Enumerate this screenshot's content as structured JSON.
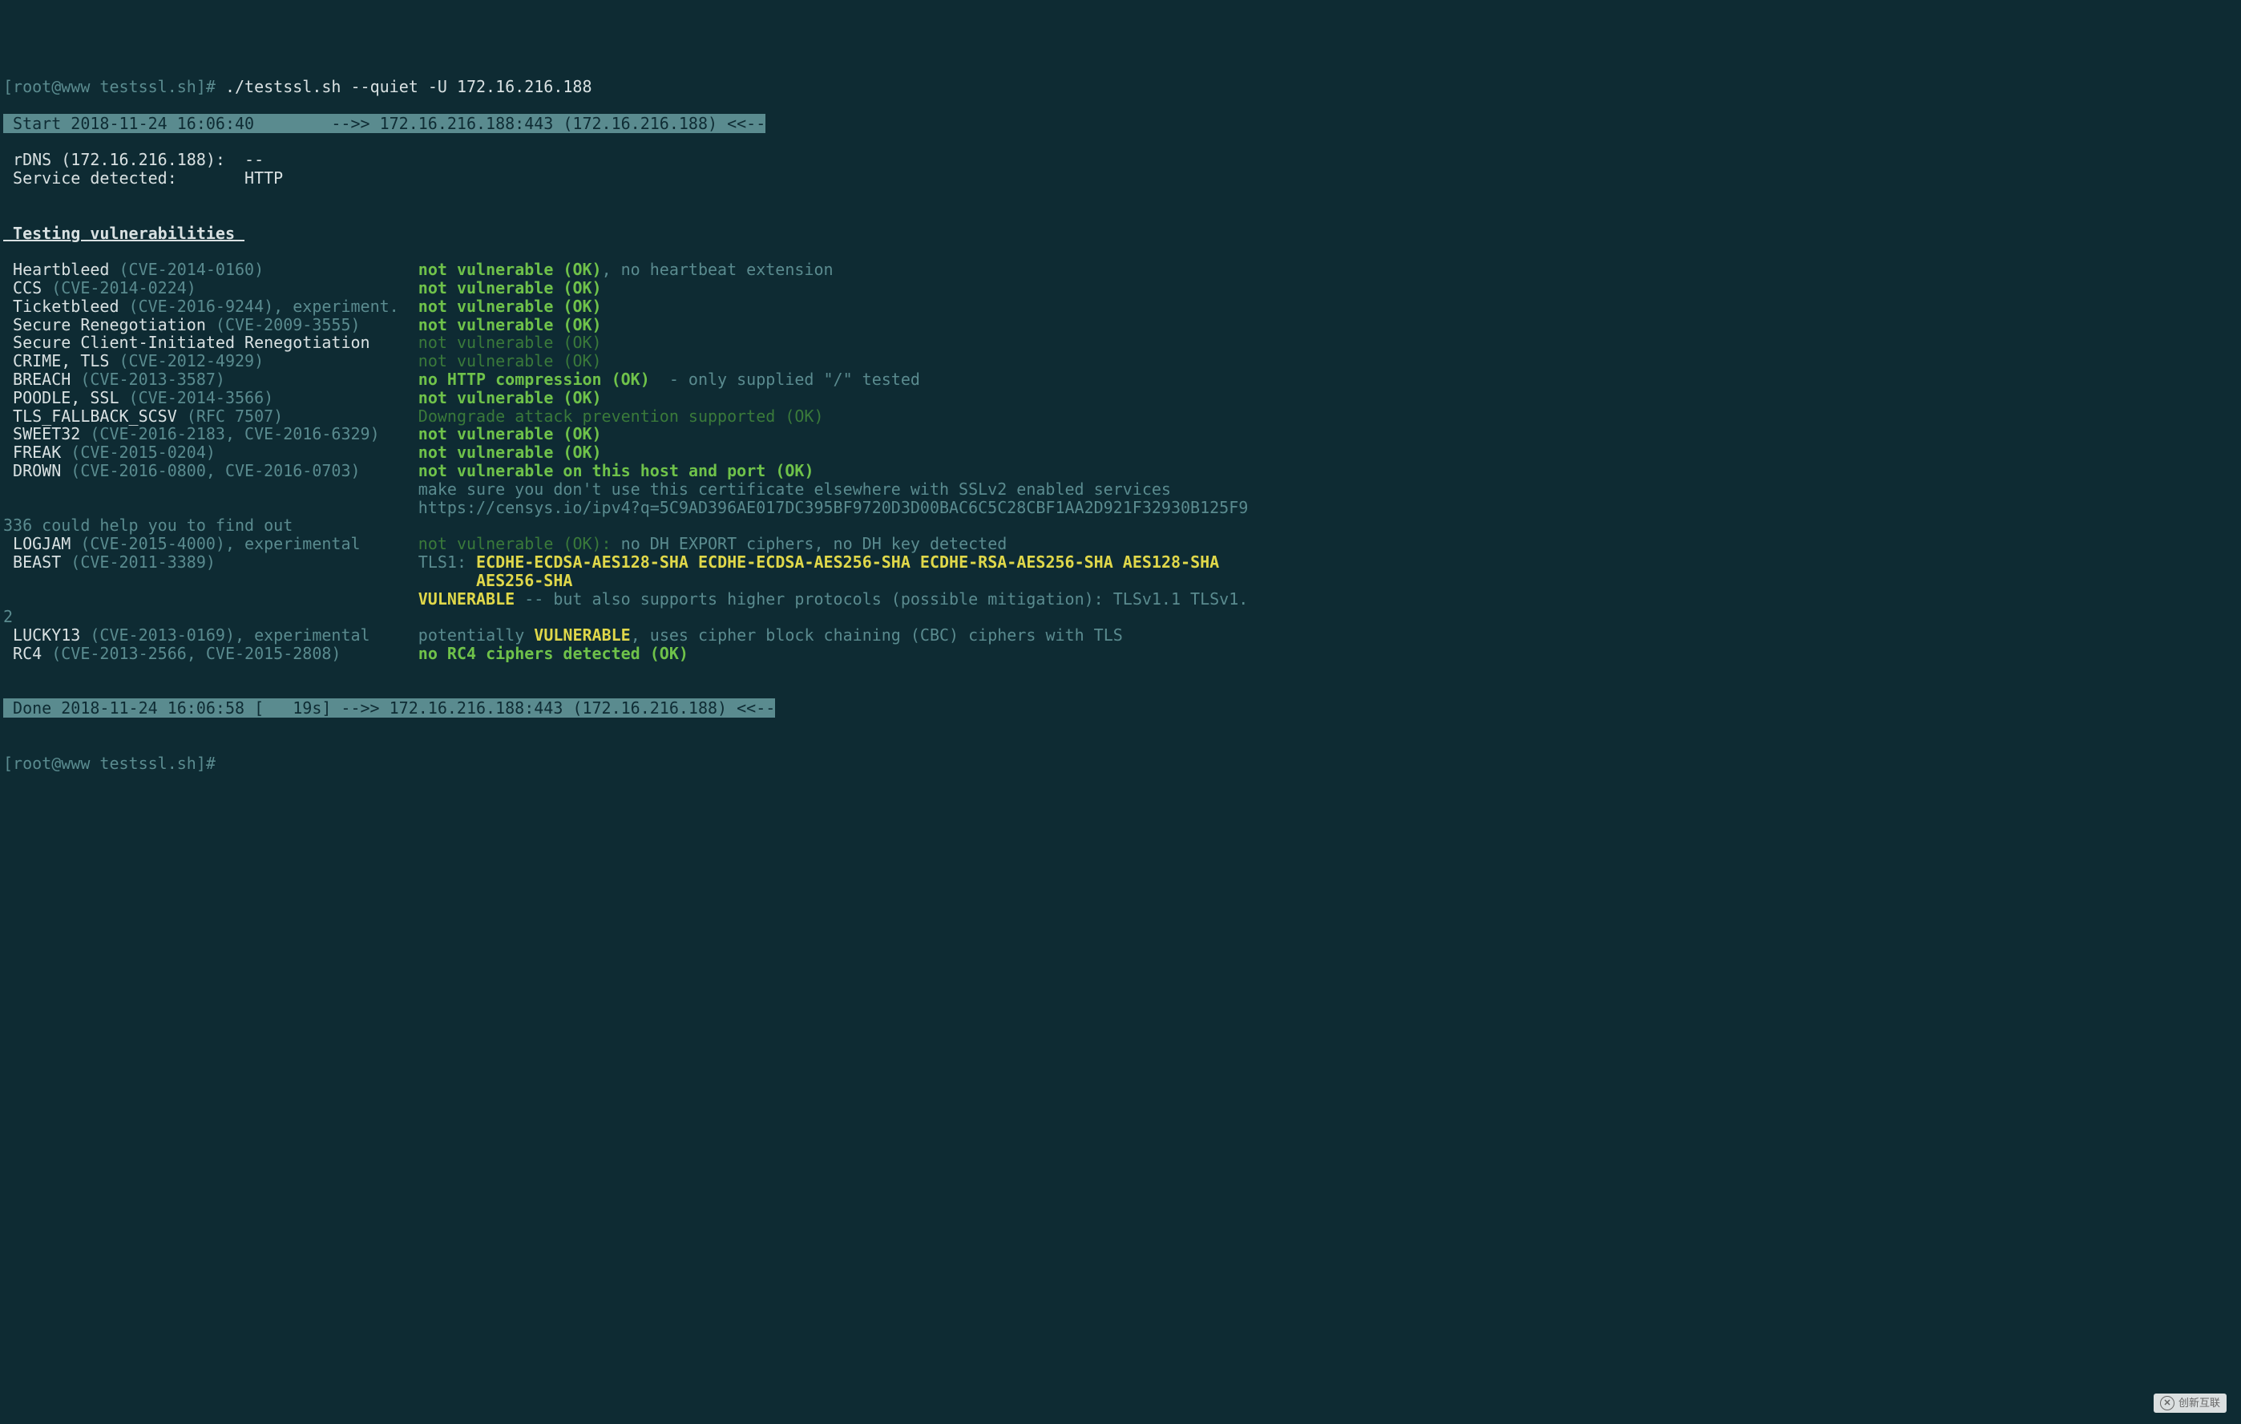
{
  "prompt1": "[root@www testssl.sh]# ",
  "command": "./testssl.sh --quiet -U 172.16.216.188",
  "banner_start": " Start 2018-11-24 16:06:40        -->> 172.16.216.188:443 (172.16.216.188) <<--",
  "rdns_line": " rDNS (172.16.216.188):  --",
  "service_line": " Service detected:       HTTP",
  "section_title": " Testing vulnerabilities ",
  "vulns": [
    {
      "name": "Heartbleed",
      "cve": " (CVE-2014-0160)                ",
      "status": "not vulnerable (OK)",
      "status_class": "green-bold",
      "suffix_grey": ", no heartbeat extension"
    },
    {
      "prefix_pad": " ",
      "name": "CCS",
      "cve": " (CVE-2014-0224)                       ",
      "status": "not vulnerable (OK)",
      "status_class": "green-bold"
    },
    {
      "prefix_pad": " ",
      "name": "Ticketbleed",
      "cve": " (CVE-2016-9244), experiment.  ",
      "status": "not vulnerable (OK)",
      "status_class": "green-bold"
    },
    {
      "prefix_pad": " ",
      "name": "Secure Renegotiation ",
      "cve": "(CVE-2009-3555)      ",
      "status": "not vulnerable (OK)",
      "status_class": "green-bold"
    },
    {
      "prefix_pad": " ",
      "name": "Secure Client-Initiated Renegotiation     ",
      "cve": "",
      "status": "not vulnerable (OK)",
      "status_class": "dark-green"
    },
    {
      "prefix_pad": " ",
      "name": "CRIME, TLS",
      "cve": " (CVE-2012-4929)                ",
      "status": "not vulnerable (OK)",
      "status_class": "dark-green"
    },
    {
      "prefix_pad": " ",
      "name": "BREACH",
      "cve": " (CVE-2013-3587)                    ",
      "status": "no HTTP compression (OK) ",
      "status_class": "green-bold",
      "suffix_grey": " - only supplied \"/\" tested"
    },
    {
      "prefix_pad": " ",
      "name": "POODLE, SSL",
      "cve": " (CVE-2014-3566)               ",
      "status": "not vulnerable (OK)",
      "status_class": "green-bold"
    },
    {
      "prefix_pad": " ",
      "name": "TLS_FALLBACK_SCSV",
      "cve": " (RFC 7507)              ",
      "status": "Downgrade attack prevention supported (OK)",
      "status_class": "dark-green"
    },
    {
      "prefix_pad": " ",
      "name": "SWEET32",
      "cve": " (CVE-2016-2183, CVE-2016-6329)    ",
      "status": "not vulnerable (OK)",
      "status_class": "green-bold"
    },
    {
      "prefix_pad": " ",
      "name": "FREAK",
      "cve": " (CVE-2015-0204)                     ",
      "status": "not vulnerable (OK)",
      "status_class": "green-bold"
    },
    {
      "prefix_pad": " ",
      "name": "DROWN",
      "cve": " (CVE-2016-0800, CVE-2016-0703)      ",
      "status": "not vulnerable on this host and port (OK)",
      "status_class": "green-bold"
    }
  ],
  "drown_line1": "                                           make sure you don't use this certificate elsewhere with SSLv2 enabled services",
  "drown_line2": "                                           https://censys.io/ipv4?q=5C9AD396AE017DC395BF9720D3D00BAC6C5C28CBF1AA2D921F32930B125F9",
  "drown_wrap": "336 could help you to find out",
  "logjam": {
    "name": "LOGJAM",
    "cve": " (CVE-2015-4000), experimental      ",
    "status": "not vulnerable (OK):",
    "detail": " no DH EXPORT ciphers, no DH key detected"
  },
  "beast": {
    "name": "BEAST",
    "cve": " (CVE-2011-3389)                     ",
    "tls_label": "TLS1: ",
    "ciphers1": "ECDHE-ECDSA-AES128-SHA ECDHE-ECDSA-AES256-SHA ECDHE-RSA-AES256-SHA AES128-SHA",
    "ciphers2_pad": "                                                 ",
    "ciphers2": "AES256-SHA",
    "vuln_pad": "                                           ",
    "vuln_label": "VULNERABLE",
    "vuln_suffix": " -- but also supports higher protocols (possible mitigation): TLSv1.1 TLSv1.",
    "wrap": "2"
  },
  "lucky13": {
    "name": "LUCKY13",
    "cve": " (CVE-2013-0169), experimental     ",
    "prefix": "potentially ",
    "vuln": "VULNERABLE",
    "suffix": ", uses cipher block chaining (CBC) ciphers with TLS"
  },
  "rc4": {
    "name": "RC4",
    "cve": " (CVE-2013-2566, CVE-2015-2808)        ",
    "status": "no RC4 ciphers detected (OK)"
  },
  "banner_done": " Done 2018-11-24 16:06:58 [   19s] -->> 172.16.216.188:443 (172.16.216.188) <<--",
  "prompt2": "[root@www testssl.sh]# ",
  "watermark": "创新互联"
}
